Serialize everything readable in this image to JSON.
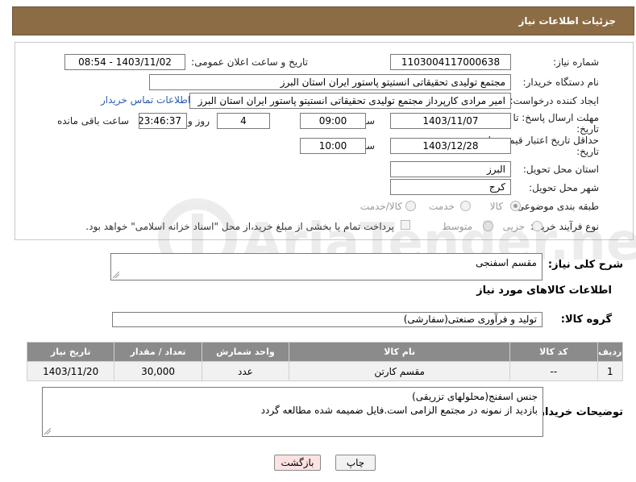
{
  "header": {
    "title": "جزئیات اطلاعات نیاز"
  },
  "form": {
    "need_number": {
      "label": "شماره نیاز:",
      "value": "1103004117000638"
    },
    "announce_datetime": {
      "label": "تاریخ و ساعت اعلان عمومی:",
      "value": "1403/11/02 - 08:54"
    },
    "buyer_org": {
      "label": "نام دستگاه خریدار:",
      "value": "مجتمع تولیدی تحقیقاتی انستیتو پاستور ایران استان البرز"
    },
    "requester": {
      "label": "ایجاد کننده درخواست:",
      "value": "امیر مرادی کارپرداز مجتمع تولیدی تحقیقاتی انستیتو پاستور ایران استان البرز",
      "contact_link": "اطلاعات تماس خریدار"
    },
    "reply_deadline": {
      "label_line1": "مهلت ارسال پاسخ: تا",
      "label_line2": "تاریخ:",
      "date": "1403/11/07",
      "time_label": "ساعت",
      "time": "09:00",
      "days": "4",
      "days_label": "روز و",
      "remaining": "23:46:37",
      "remaining_label": "ساعت باقی مانده"
    },
    "price_validity": {
      "label_line1": "حداقل تاریخ اعتبار قیمت: تا",
      "label_line2": "تاریخ:",
      "date": "1403/12/28",
      "time_label": "ساعت",
      "time": "10:00"
    },
    "delivery_province": {
      "label": "استان محل تحویل:",
      "value": "البرز"
    },
    "delivery_city": {
      "label": "شهر محل تحویل:",
      "value": "کرج"
    },
    "category": {
      "label": "طبقه بندی موضوعی:",
      "options": [
        "کالا",
        "خدمت",
        "کالا/خدمت"
      ],
      "selected": "کالا"
    },
    "purchase_process": {
      "label": "نوع فرآیند خرید :",
      "options": [
        "جزیی",
        "متوسط"
      ],
      "selected": "جزیی",
      "payment_note": "پرداخت تمام یا بخشی از مبلغ خرید،از محل \"اسناد خزانه اسلامی\" خواهد بود."
    }
  },
  "summary": {
    "label": "شرح کلی نیاز:",
    "value": "مقسم اسفنجی"
  },
  "goods_section": {
    "title": "اطلاعات کالاهای مورد نیاز"
  },
  "goods_group": {
    "label": "گروه کالا:",
    "value": "تولید و فرآوری صنعتی(سفارشی)"
  },
  "table": {
    "headers": [
      "ردیف",
      "کد کالا",
      "نام کالا",
      "واحد شمارش",
      "تعداد / مقدار",
      "تاریخ نیاز"
    ],
    "rows": [
      {
        "row": "1",
        "code": "--",
        "name": "مقسم کارتن",
        "unit": "عدد",
        "qty": "30,000",
        "date": "1403/11/20"
      }
    ]
  },
  "buyer_notes": {
    "label": "توضیحات خریدار:",
    "line1": "جنس اسفنج(محلولهای تزریقی)",
    "line2": "بازدید از نمونه در مجتمع الزامی است.فایل ضمیمه شده مطالعه گردد"
  },
  "buttons": {
    "print": "چاپ",
    "back": "بازگشت"
  },
  "watermark": {
    "text": "AriaTender.neT"
  },
  "colors": {
    "header_bg": "#8b6c45",
    "table_header_bg": "#8b8b8b",
    "back_button_bg": "#fde2e2",
    "link": "#2a5db0"
  }
}
